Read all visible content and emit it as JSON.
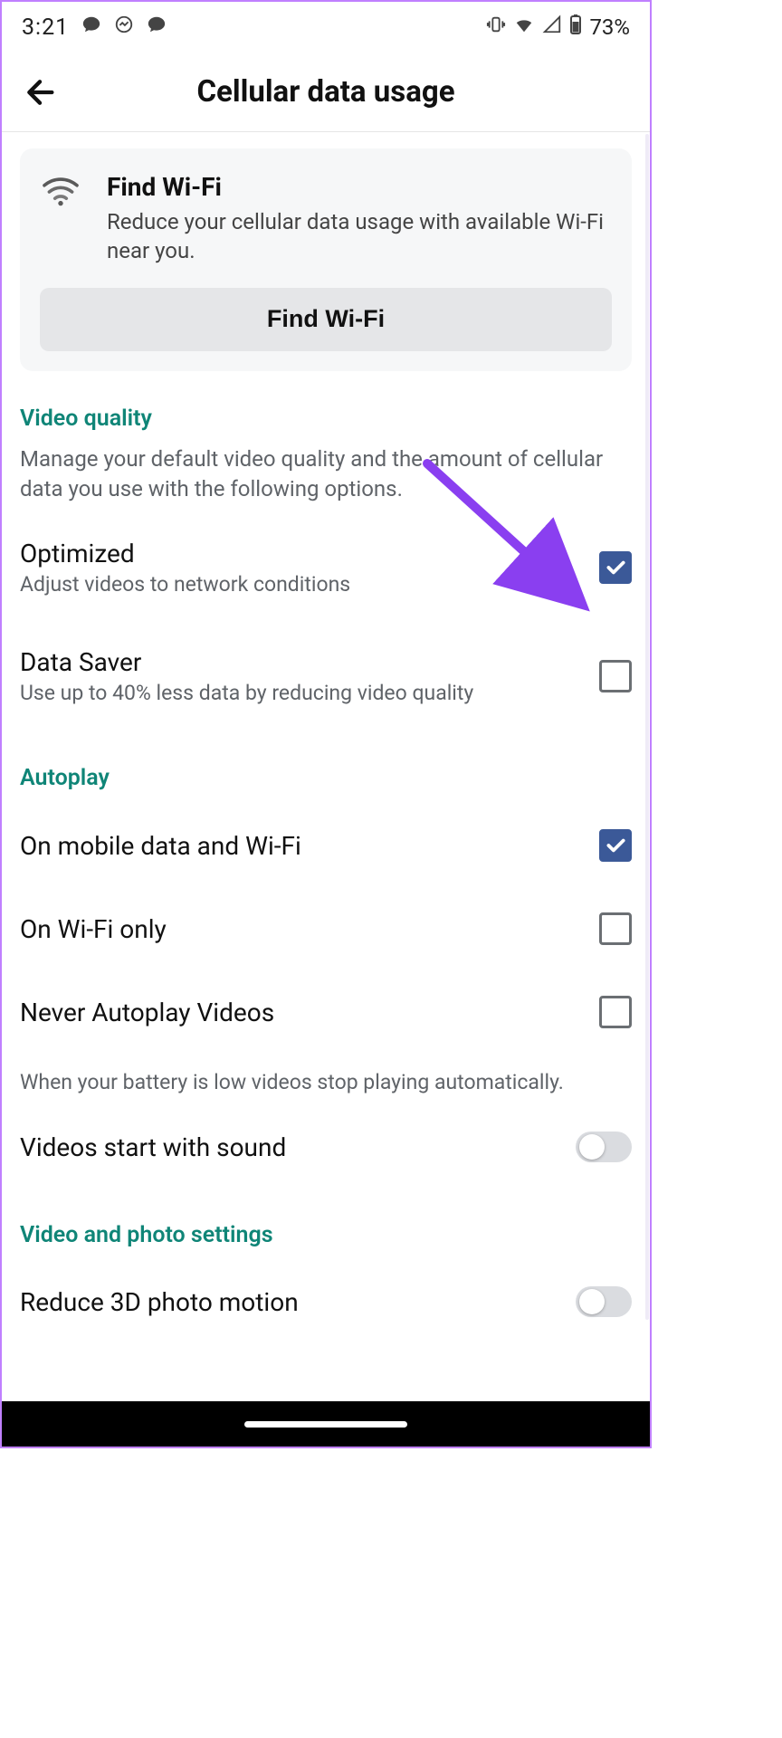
{
  "statusbar": {
    "time": "3:21",
    "battery": "73%"
  },
  "header": {
    "title": "Cellular data usage"
  },
  "find_wifi": {
    "title": "Find Wi-Fi",
    "desc": "Reduce your cellular data usage with available Wi-Fi near you.",
    "button": "Find Wi-Fi"
  },
  "video_quality": {
    "heading": "Video quality",
    "desc": "Manage your default video quality and the amount of cellular data you use with the following options.",
    "optimized": {
      "title": "Optimized",
      "sub": "Adjust videos to network conditions",
      "checked": true
    },
    "data_saver": {
      "title": "Data Saver",
      "sub": "Use up to 40% less data by reducing video quality",
      "checked": false
    }
  },
  "autoplay": {
    "heading": "Autoplay",
    "opt1": {
      "title": "On mobile data and Wi-Fi",
      "checked": true
    },
    "opt2": {
      "title": "On Wi-Fi only",
      "checked": false
    },
    "opt3": {
      "title": "Never Autoplay Videos",
      "checked": false
    },
    "note": "When your battery is low videos stop playing automatically."
  },
  "videos_sound": {
    "label": "Videos start with sound",
    "on": false
  },
  "vp_settings": {
    "heading": "Video and photo settings",
    "reduce3d": {
      "label": "Reduce 3D photo motion",
      "on": false
    }
  }
}
